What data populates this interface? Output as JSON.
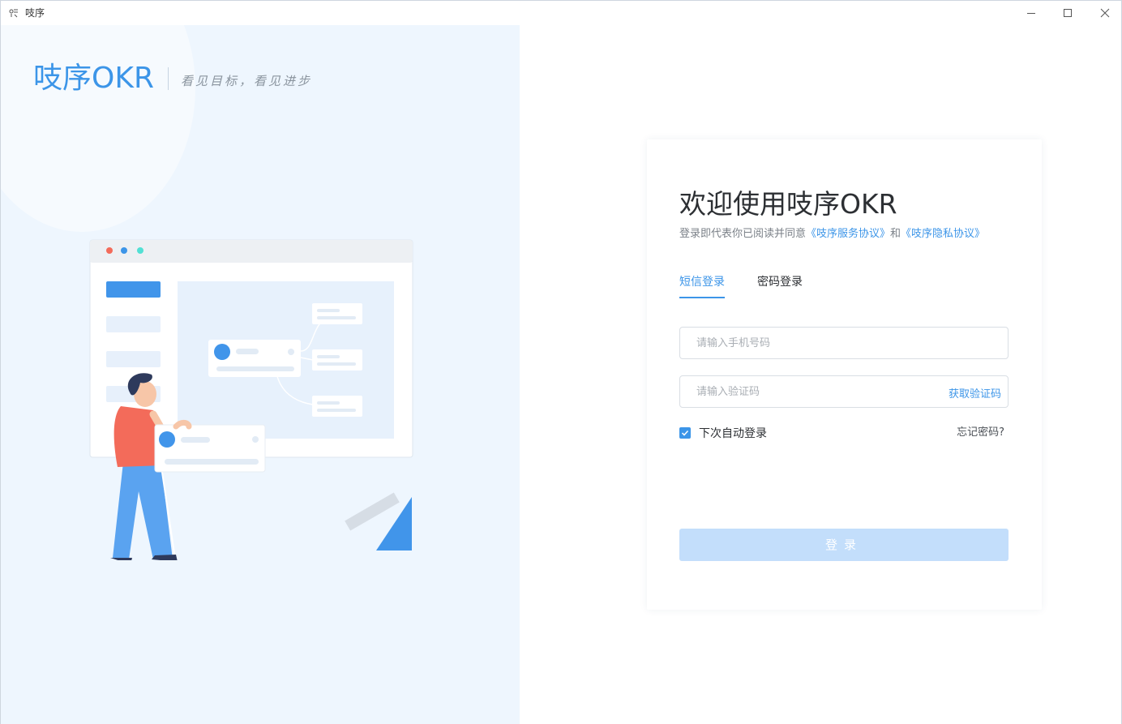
{
  "window": {
    "title": "吱序",
    "controls": {
      "minimize_icon": "minimize-icon",
      "maximize_icon": "maximize-icon",
      "close_icon": "close-icon"
    }
  },
  "brand": {
    "logo_text": "吱序OKR",
    "slogan": "看见目标，看见进步",
    "accent_color": "#3c95e8"
  },
  "login": {
    "title": "欢迎使用吱序OKR",
    "agreement_prefix": "登录即代表你已阅读并同意",
    "service_agreement": "《吱序服务协议》",
    "conjunction": "和",
    "privacy_agreement": "《吱序隐私协议》",
    "tabs": [
      {
        "label": "短信登录",
        "active": true
      },
      {
        "label": "密码登录",
        "active": false
      }
    ],
    "phone_placeholder": "请输入手机号码",
    "code_placeholder": "请输入验证码",
    "get_code_label": "获取验证码",
    "remember_label": "下次自动登录",
    "remember_checked": true,
    "forgot_label": "忘记密码?",
    "submit_label": "登录",
    "submit_color_disabled": "#c3defb"
  }
}
